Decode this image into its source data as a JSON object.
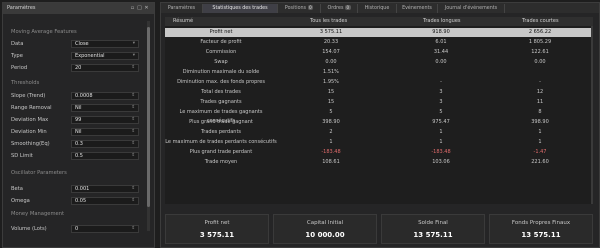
{
  "left_panel": {
    "title": "Paramètres",
    "sections": {
      "ma": "Moving Average Features",
      "thresholds": "Thresholds",
      "oscillator": "Oscillator Parameters",
      "money": "Money Management"
    },
    "fields": {
      "data": {
        "label": "Data",
        "value": "Close"
      },
      "type": {
        "label": "Type",
        "value": "Exponential"
      },
      "period": {
        "label": "Period",
        "value": "20"
      },
      "slope": {
        "label": "Slope (Trend)",
        "value": "0.0008"
      },
      "range_removal": {
        "label": "Range Removal",
        "value": "Nil"
      },
      "deviation_max": {
        "label": "Deviation Max",
        "value": "99"
      },
      "deviation_min": {
        "label": "Deviation Min",
        "value": "Nil"
      },
      "smoothing": {
        "label": "Smoothing(Eq)",
        "value": "0.3"
      },
      "sd_limit": {
        "label": "SD Limit",
        "value": "0.5"
      },
      "beta": {
        "label": "Beta",
        "value": "0.001"
      },
      "omega": {
        "label": "Omega",
        "value": "0.05"
      },
      "volume": {
        "label": "Volume (Lots)",
        "value": "0"
      }
    }
  },
  "tabs": [
    {
      "label": "Paramètres"
    },
    {
      "label": "Statistiques des trades"
    },
    {
      "label": "Positions",
      "badge": "0"
    },
    {
      "label": "Ordres",
      "badge": "0"
    },
    {
      "label": "Historique"
    },
    {
      "label": "Evénements"
    },
    {
      "label": "Journal d'événements"
    }
  ],
  "table": {
    "headers": [
      "Résumé",
      "Tous les trades",
      "Trades longues",
      "Trades courtes"
    ],
    "rows": [
      [
        "Profit net",
        "3 575.11",
        "918.90",
        "2 656.22"
      ],
      [
        "Facteur de profit",
        "20.33",
        "6.01",
        "1 805.29"
      ],
      [
        "Commission",
        "154.07",
        "31.44",
        "122.61"
      ],
      [
        "Swap",
        "0.00",
        "0.00",
        "0.00"
      ],
      [
        "Diminution maximale du solde",
        "1.51%",
        "",
        ""
      ],
      [
        "Diminution max. des fonds propres",
        "1.95%",
        "-",
        "-"
      ],
      [
        "Total des trades",
        "15",
        "3",
        "12"
      ],
      [
        "Trades gagnants",
        "15",
        "3",
        "11"
      ],
      [
        "Le maximum de trades gagnants consécutifs",
        "5",
        "5",
        "8"
      ],
      [
        "Plus grand trade gagnant",
        "398.90",
        "975.47",
        "398.90"
      ],
      [
        "Trades perdants",
        "2",
        "1",
        "1"
      ],
      [
        "Le maximum de trades perdants consécutifs",
        "1",
        "1",
        "1"
      ],
      [
        "Plus grand trade perdant",
        "-183.48",
        "-183.48",
        "-1.47"
      ],
      [
        "Trade moyen",
        "108.61",
        "103.06",
        "221.60"
      ]
    ]
  },
  "cards": [
    {
      "title": "Profit net",
      "value": "3 575.11"
    },
    {
      "title": "Capital Initial",
      "value": "10 000.00"
    },
    {
      "title": "Solde Final",
      "value": "13 575.11"
    },
    {
      "title": "Fonds Propres Finaux",
      "value": "13 575.11"
    }
  ],
  "colors": {
    "negative": "#e06b6b",
    "selected_row": "#c8c8c8"
  }
}
